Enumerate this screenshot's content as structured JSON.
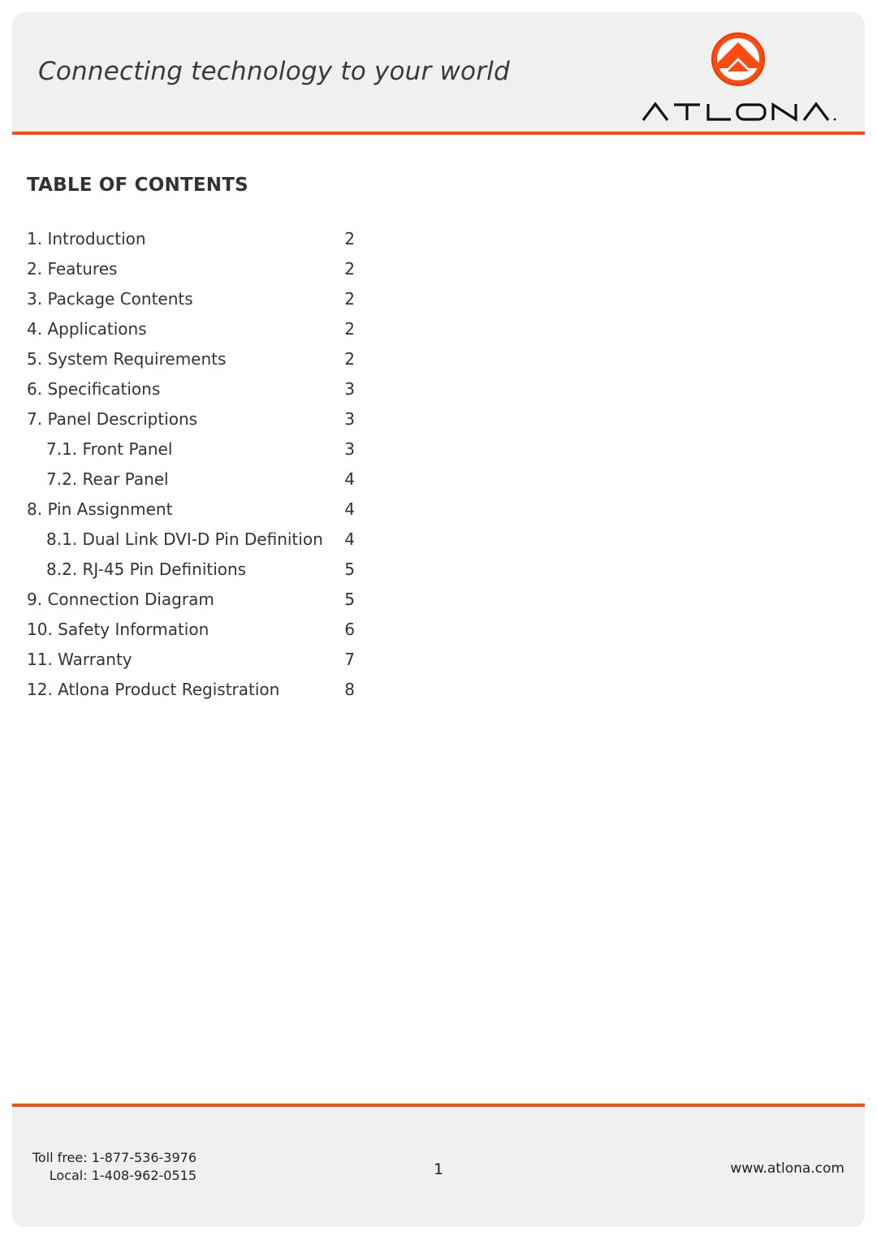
{
  "header": {
    "tagline": "Connecting technology to your world",
    "brand": "ATLONA",
    "brand_mark": "atlona-logo-icon",
    "accent_color": "#ff4a12"
  },
  "toc": {
    "title": "TABLE OF CONTENTS",
    "items": [
      {
        "label": "1. Introduction",
        "page": "2",
        "level": 1
      },
      {
        "label": "2. Features",
        "page": "2",
        "level": 1
      },
      {
        "label": "3. Package Contents",
        "page": "2",
        "level": 1
      },
      {
        "label": "4. Applications",
        "page": "2",
        "level": 1
      },
      {
        "label": "5. System Requirements",
        "page": "2",
        "level": 1
      },
      {
        "label": "6. Specifications",
        "page": "3",
        "level": 1
      },
      {
        "label": "7. Panel Descriptions",
        "page": "3",
        "level": 1
      },
      {
        "label": "7.1. Front Panel",
        "page": "3",
        "level": 2
      },
      {
        "label": "7.2. Rear Panel",
        "page": "4",
        "level": 2
      },
      {
        "label": "8. Pin Assignment",
        "page": "4",
        "level": 1
      },
      {
        "label": "8.1. Dual Link DVI-D Pin Definition",
        "page": "4",
        "level": 2
      },
      {
        "label": "8.2. RJ-45 Pin Definitions",
        "page": "5",
        "level": 2
      },
      {
        "label": "9. Connection Diagram",
        "page": "5",
        "level": 1
      },
      {
        "label": "10. Safety Information",
        "page": "6",
        "level": 1
      },
      {
        "label": "11. Warranty",
        "page": "7",
        "level": 1
      },
      {
        "label": "12. Atlona Product Registration",
        "page": "8",
        "level": 1
      }
    ]
  },
  "footer": {
    "toll_free": "Toll free: 1-877-536-3976",
    "local": "Local: 1-408-962-0515",
    "page_number": "1",
    "website": "www.atlona.com"
  }
}
